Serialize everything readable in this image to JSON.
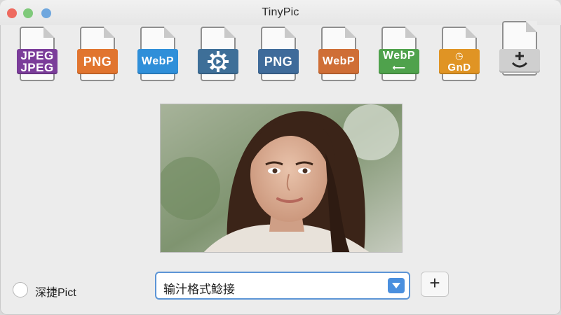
{
  "window": {
    "title": "TinyPic"
  },
  "toolbar": {
    "formats": [
      {
        "kind": "JPEG",
        "text": [
          "JPEG",
          "JPEG"
        ],
        "color": "#7b3d9a"
      },
      {
        "kind": "PNG",
        "text": [
          "PNG"
        ],
        "color": "#e1752f"
      },
      {
        "kind": "WebP",
        "text": [
          "WebP"
        ],
        "color": "#2f8fd9"
      },
      {
        "kind": "Settings",
        "text": [],
        "color": "#3e6f98"
      },
      {
        "kind": "PNG",
        "text": [
          "PNG"
        ],
        "color": "#3f6b9a"
      },
      {
        "kind": "WebP",
        "text": [
          "WebP"
        ],
        "color": "#cf6e36"
      },
      {
        "kind": "WebP",
        "text": [
          "WebP"
        ],
        "color": "#4fa24c"
      },
      {
        "kind": "GnD",
        "text": [
          "GnD"
        ],
        "color": "#e09424"
      },
      {
        "kind": "Add",
        "text": [],
        "color": "#d0d0d0"
      }
    ]
  },
  "preview": {
    "subject": "woman-portrait"
  },
  "bottom": {
    "checkbox_label": "深捷Pict",
    "select_value": "输汁格式鲶接",
    "add_label": "+"
  },
  "colors": {
    "accent": "#4a8fde",
    "window_bg": "#ececec"
  }
}
